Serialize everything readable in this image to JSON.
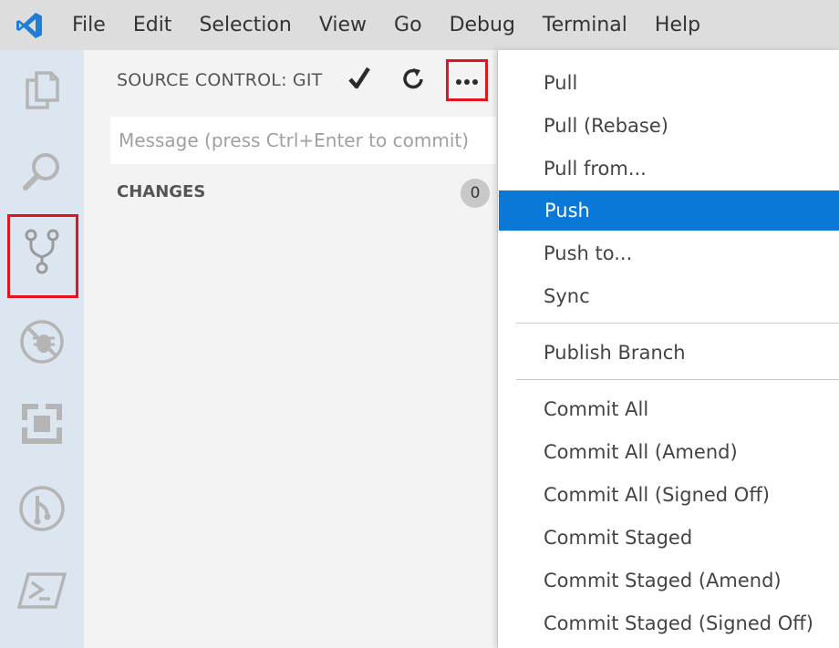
{
  "menubar": {
    "logo_icon": "vscode-logo-icon",
    "items": [
      "File",
      "Edit",
      "Selection",
      "View",
      "Go",
      "Debug",
      "Terminal",
      "Help"
    ]
  },
  "activitybar": {
    "items": [
      {
        "icon": "explorer-icon"
      },
      {
        "icon": "search-icon"
      },
      {
        "icon": "source-control-icon",
        "highlighted": true
      },
      {
        "icon": "debug-icon"
      },
      {
        "icon": "extensions-icon"
      },
      {
        "icon": "gitlens-icon"
      },
      {
        "icon": "powershell-icon"
      }
    ]
  },
  "sidepanel": {
    "title": "SOURCE CONTROL: GIT",
    "commit_placeholder": "Message (press Ctrl+Enter to commit)",
    "changes_label": "CHANGES",
    "changes_count": "0",
    "toolbar_icons": [
      "checkmark-icon",
      "refresh-icon",
      "more-actions-icon"
    ]
  },
  "context_menu": {
    "groups": [
      [
        "Pull",
        "Pull (Rebase)",
        "Pull from...",
        "Push",
        "Push to...",
        "Sync"
      ],
      [
        "Publish Branch"
      ],
      [
        "Commit All",
        "Commit All (Amend)",
        "Commit All (Signed Off)",
        "Commit Staged",
        "Commit Staged (Amend)",
        "Commit Staged (Signed Off)"
      ]
    ],
    "selected": "Push"
  },
  "colors": {
    "accent": "#0a78d7",
    "highlight_box": "#e3141f",
    "activity_bar": "#dce6f1"
  }
}
